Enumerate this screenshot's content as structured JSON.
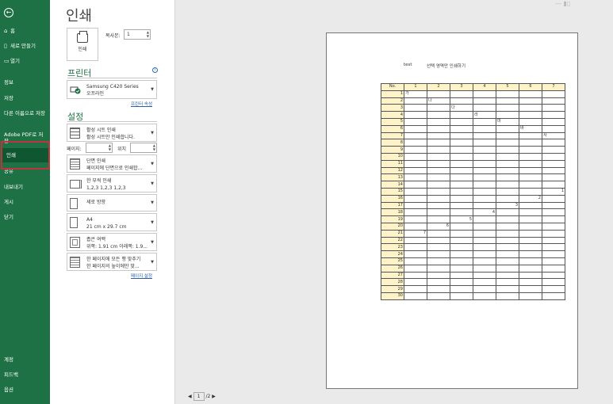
{
  "sidebar": {
    "home": "홈",
    "new": "새로 만들기",
    "open": "열기",
    "info": "정보",
    "save": "저장",
    "save_as": "다른 이름으로 저장",
    "save_pdf": "Adobe PDF로 저장",
    "print": "인쇄",
    "share": "공유",
    "export": "내보내기",
    "publish": "게시",
    "close": "닫기",
    "account": "계정",
    "feedback": "피드백",
    "options": "옵션"
  },
  "main": {
    "title": "인쇄",
    "print_button": "인쇄",
    "copies_label": "복사본:",
    "copies_value": "1",
    "printer_section": "프린터",
    "printer_name": "Samsung C420 Series",
    "printer_status": "오프라인",
    "printer_properties": "프린터 속성",
    "settings_section": "설정",
    "setting1_line1": "활성 시트 인쇄",
    "setting1_line2": "활성 시트만 인쇄합니다.",
    "pages_label": "페이지:",
    "to_label": "위치",
    "setting2_line1": "단면 인쇄",
    "setting2_line2": "페이지에 단면으로 인쇄합...",
    "setting3_line1": "한 부씩 인쇄",
    "setting3_line2": "1,2,3    1,2,3    1,2,3",
    "setting4_line1": "세로 방향",
    "setting5_line1": "A4",
    "setting5_line2": "21 cm x 29.7 cm",
    "setting6_line1": "좁은 여백",
    "setting6_line2": "위쪽: 1.91 cm 아래쪽: 1.9...",
    "setting7_line1": "한 페이지에 모든 행 맞추기",
    "setting7_line2": "한 페이지의 높이에만 맞...",
    "page_setup": "페이지 설정"
  },
  "preview": {
    "text1": "test",
    "text2": "선택 영역만 인쇄하기",
    "current_page": "1",
    "total_pages": "/2",
    "headers": [
      "No.",
      "1",
      "2",
      "3",
      "4",
      "5",
      "6",
      "7"
    ]
  },
  "colors": {
    "accent": "#1e7145",
    "highlight": "#c0333a",
    "header_fill": "#fdf2c8"
  }
}
